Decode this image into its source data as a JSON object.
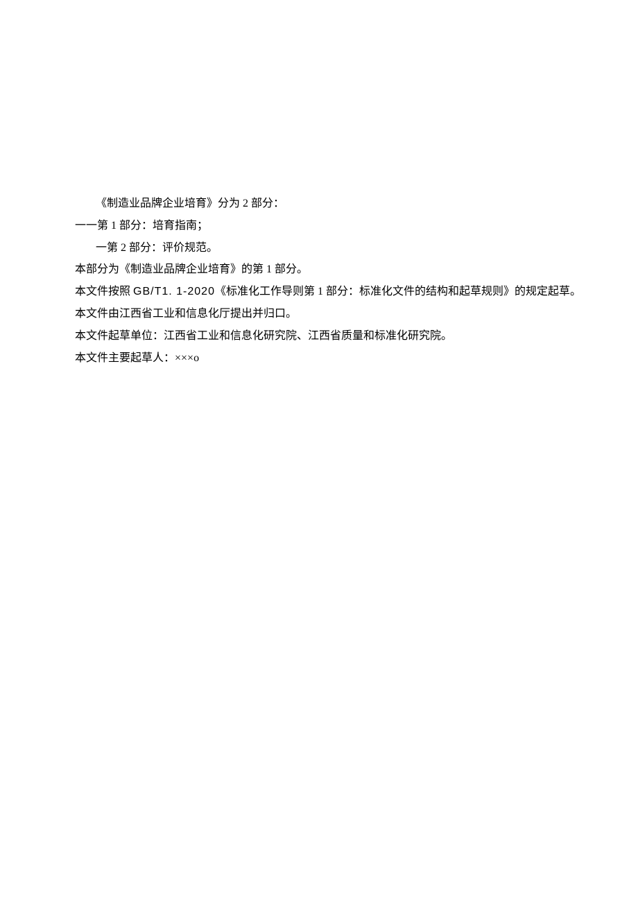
{
  "lines": {
    "l1": "《制造业品牌企业培育》分为 2 部分：",
    "l2": "一一第 1 部分：培育指南；",
    "l3": "一第 2 部分：评价规范。",
    "l4": "本部分为《制造业品牌企业培育》的第 1 部分。",
    "l5_prefix": "本文件按照 ",
    "l5_code": "GB/T1. 1-2020",
    "l5_suffix": "《标准化工作导则第 1 部分：标准化文件的结构和起草规则》的规定起草。",
    "l6": "本文件由江西省工业和信息化厅提出并归口。",
    "l7": "本文件起草单位：江西省工业和信息化研究院、江西省质量和标准化研究院。",
    "l8": "本文件主要起草人：×××o"
  }
}
